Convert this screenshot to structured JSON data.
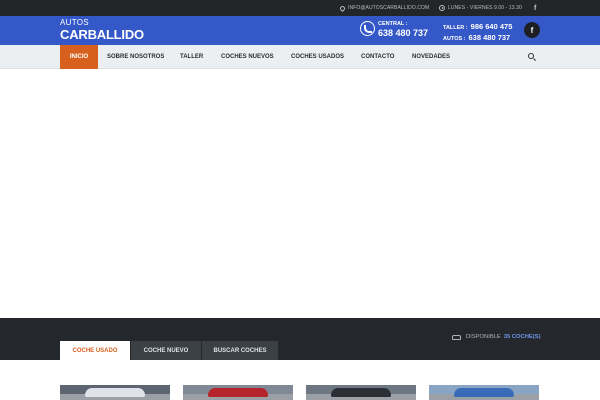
{
  "topbar": {
    "email": "INFO@AUTOSCARBALLIDO.COM",
    "hours": "LUNES - VIERNES 9.00 - 13.30",
    "facebook_glyph": "f",
    "icons": [
      "location-pin-icon",
      "clock-icon",
      "facebook-icon"
    ]
  },
  "header": {
    "logo_top": "AUTOS",
    "logo_main": "CARBALLIDO",
    "central_label": "CENTRAL :",
    "central_number": "638 480 737",
    "taller_label": "TALLER :",
    "taller_number": "986 640 475",
    "autos_label": "AUTOS :",
    "autos_number": "638 480 737",
    "facebook_glyph": "f",
    "brand_color": "#3458c8"
  },
  "nav": {
    "items": [
      {
        "label": "INICIO",
        "active": true
      },
      {
        "label": "SOBRE NOSOTROS",
        "active": false
      },
      {
        "label": "TALLER",
        "active": false
      },
      {
        "label": "COCHES NUEVOS",
        "active": false
      },
      {
        "label": "COCHES USADOS",
        "active": false
      },
      {
        "label": "CONTACTO",
        "active": false
      },
      {
        "label": "NOVEDADES",
        "active": false
      }
    ],
    "accent_color": "#d8601e",
    "search_icon": "search-icon"
  },
  "inventory": {
    "available_label": "DISPONIBLE",
    "available_count": "35 COCHE(S)",
    "tabs": [
      {
        "label": "COCHE USADO",
        "active": true
      },
      {
        "label": "COCHE NUEVO",
        "active": false
      },
      {
        "label": "BUSCAR COCHES",
        "active": false
      }
    ]
  }
}
